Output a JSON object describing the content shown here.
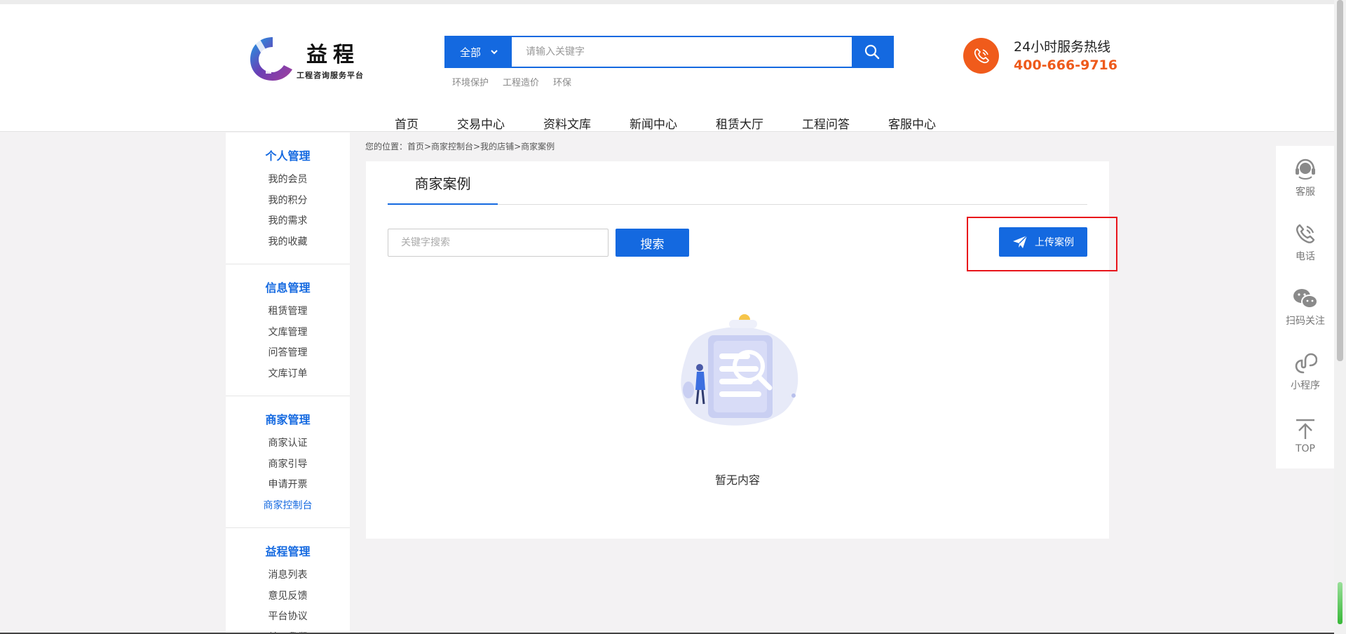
{
  "header": {
    "logo": {
      "title": "益程",
      "subtitle": "工程咨询服务平台"
    },
    "search": {
      "category": "全部",
      "placeholder": "请输入关键字",
      "hot_keywords": [
        "环境保护",
        "工程造价",
        "环保"
      ]
    },
    "hotline": {
      "label": "24小时服务热线",
      "phone": "400-666-9716"
    },
    "nav": [
      "首页",
      "交易中心",
      "资料文库",
      "新闻中心",
      "租赁大厅",
      "工程问答",
      "客服中心"
    ]
  },
  "sidebar": {
    "groups": [
      {
        "title": "个人管理",
        "items": [
          "我的会员",
          "我的积分",
          "我的需求",
          "我的收藏"
        ]
      },
      {
        "title": "信息管理",
        "items": [
          "租赁管理",
          "文库管理",
          "问答管理",
          "文库订单"
        ]
      },
      {
        "title": "商家管理",
        "items": [
          "商家认证",
          "商家引导",
          "申请开票",
          "商家控制台"
        ]
      },
      {
        "title": "益程管理",
        "items": [
          "消息列表",
          "意见反馈",
          "平台协议",
          "关于我们"
        ]
      }
    ],
    "active_item": "商家控制台"
  },
  "breadcrumb": "您的位置：首页>商家控制台>我的店铺>商家案例",
  "main": {
    "tab_label": "商家案例",
    "keyword_placeholder": "关键字搜索",
    "search_button": "搜索",
    "upload_button": "上传案例",
    "empty_text": "暂无内容"
  },
  "floatbar": [
    {
      "label": "客服",
      "icon": "headset-icon"
    },
    {
      "label": "电话",
      "icon": "phone-icon"
    },
    {
      "label": "扫码关注",
      "icon": "wechat-icon"
    },
    {
      "label": "小程序",
      "icon": "mini-program-icon"
    },
    {
      "label": "TOP",
      "icon": "arrow-up-icon"
    }
  ],
  "colors": {
    "primary": "#1469e0",
    "hotline": "#ee5a1b",
    "highlight": "#e8141a",
    "background": "#f3f2f3"
  }
}
